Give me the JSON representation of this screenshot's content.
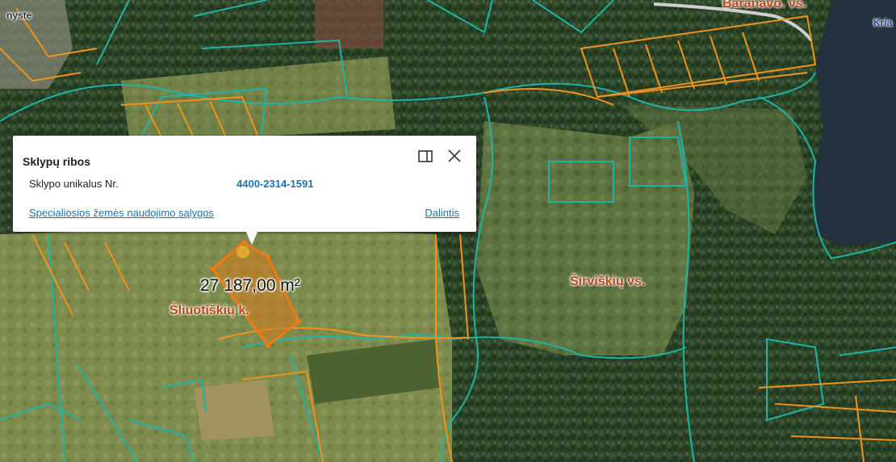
{
  "popup": {
    "title": "Sklypų ribos",
    "row_label": "Sklypo unikalus Nr.",
    "row_value": "4400-2314-1591",
    "link_left": "Specialiosios žemės naudojimo sąlygos",
    "link_right": "Dalintis",
    "maximize_icon": "maximize-icon",
    "close_icon": "close-icon"
  },
  "map": {
    "area_label": "27 187,00 m²",
    "places": {
      "siluotiskiu": "Šliuotiškių k.",
      "sirviskiu": "Širviškių vs.",
      "baranavo": "Baranavo. vs.",
      "kria": "Kria",
      "nyste": "nyste"
    },
    "colors": {
      "forest": "#2f4a2a",
      "field": "#7f8d4a",
      "parcel_teal": "#1fb3a6",
      "parcel_orange": "#f0921e",
      "selected_fill": "#d97a1c",
      "water": "#24313f"
    }
  }
}
